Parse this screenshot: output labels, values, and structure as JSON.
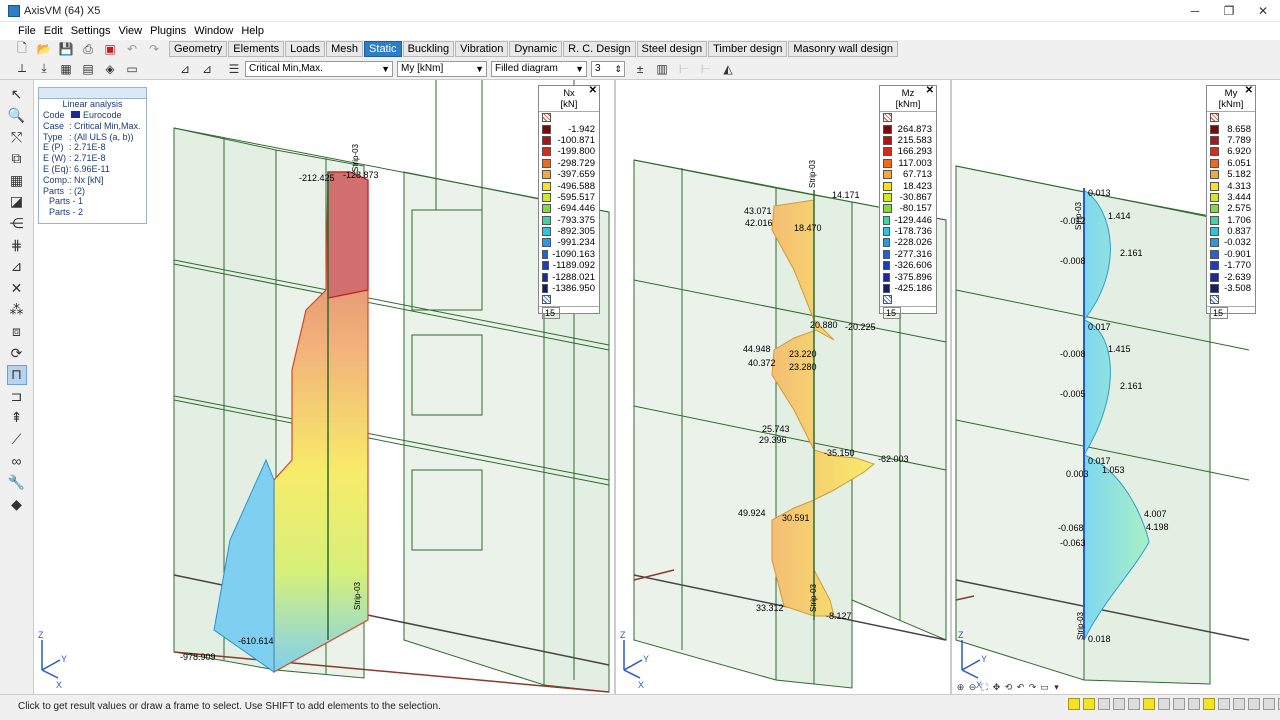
{
  "window": {
    "title": "AxisVM (64) X5",
    "buttons": [
      "─",
      "❐",
      "✕"
    ]
  },
  "menu": [
    "File",
    "Edit",
    "Settings",
    "View",
    "Plugins",
    "Window",
    "Help"
  ],
  "tabs": [
    {
      "label": "Geometry",
      "active": false
    },
    {
      "label": "Elements",
      "active": false
    },
    {
      "label": "Loads",
      "active": false
    },
    {
      "label": "Mesh",
      "active": false
    },
    {
      "label": "Static",
      "active": true
    },
    {
      "label": "Buckling",
      "active": false
    },
    {
      "label": "Vibration",
      "active": false
    },
    {
      "label": "Dynamic",
      "active": false
    },
    {
      "label": "R. C. Design",
      "active": false
    },
    {
      "label": "Steel design",
      "active": false
    },
    {
      "label": "Timber design",
      "active": false
    },
    {
      "label": "Masonry wall design",
      "active": false
    }
  ],
  "toolbar2": {
    "load_case": "Critical Min,Max.",
    "component": "My [kNm]",
    "display_mode": "Filled diagram",
    "contour_count": "3"
  },
  "info_panel": {
    "title": "Linear analysis",
    "rows": [
      {
        "k": "Code",
        "v": "Eurocode"
      },
      {
        "k": "Case",
        "v": ": Critical Min,Max."
      },
      {
        "k": "Type",
        "v": ": (All ULS  (a, b))"
      },
      {
        "k": "E (P)",
        "v": ": 2.71E-8"
      },
      {
        "k": "E (W)",
        "v": ": 2.71E-8"
      },
      {
        "k": "E (Eq)",
        "v": ": 6.96E-11"
      },
      {
        "k": "Comp.",
        "v": ": Nx [kN]"
      },
      {
        "k": "Parts",
        "v": ": (2)"
      }
    ],
    "parts": [
      "Parts - 1",
      "Parts - 2"
    ]
  },
  "legends": [
    {
      "title": "Nx",
      "unit": "[kN]",
      "count": "15",
      "values": [
        "-1.942",
        "-100.871",
        "-199.800",
        "-298.729",
        "-397.659",
        "-496.588",
        "-595.517",
        "-694.446",
        "-793.375",
        "-892.305",
        "-991.234",
        "-1090.163",
        "-1189.092",
        "-1288.021",
        "-1386.950"
      ]
    },
    {
      "title": "Mz",
      "unit": "[kNm]",
      "count": "15",
      "values": [
        "264.873",
        "215.583",
        "166.293",
        "117.003",
        "67.713",
        "18.423",
        "-30.867",
        "-80.157",
        "-129.446",
        "-178.736",
        "-228.026",
        "-277.316",
        "-326.606",
        "-375.896",
        "-425.186"
      ]
    },
    {
      "title": "My",
      "unit": "[kNm]",
      "count": "15",
      "values": [
        "8.658",
        "7.789",
        "6.920",
        "6.051",
        "5.182",
        "4.313",
        "3.444",
        "2.575",
        "1.706",
        "0.837",
        "-0.032",
        "-0.901",
        "-1.770",
        "-2.639",
        "-3.508"
      ]
    }
  ],
  "legend_colors": [
    "#7a0a0a",
    "#b11414",
    "#d62b1a",
    "#ee6a1e",
    "#f4a73c",
    "#f8e21a",
    "#cdeb29",
    "#7fdc3a",
    "#38d8a0",
    "#29c7de",
    "#2699e8",
    "#1e63d8",
    "#1b3cc2",
    "#1b2a9a",
    "#141e6b"
  ],
  "views": {
    "view1_labels": [
      "-212.425",
      "-128.873",
      "-978.909",
      "-610.614"
    ],
    "view2_labels": [
      "14.171",
      "43.071",
      "42.016",
      "18.470",
      "20.880",
      "-20.225",
      "44.948",
      "40.372",
      "23.220",
      "23.280",
      "25.743",
      "29.396",
      "-35.150",
      "-62.003",
      "49.924",
      "30.591",
      "33.312",
      "-8.127"
    ],
    "view3_labels": [
      "0.013",
      "-0.012",
      "1.414",
      "-0.008",
      "2.161",
      "0.017",
      "-0.008",
      "1.415",
      "-0.005",
      "2.161",
      "0.017",
      "0.003",
      "1.053",
      "4.007",
      "4.198",
      "-0.068",
      "-0.063",
      "0.018"
    ],
    "strip_label": "Strip-03"
  },
  "status": "Click to get result values or draw a frame to select. Use SHIFT to add elements to the selection."
}
